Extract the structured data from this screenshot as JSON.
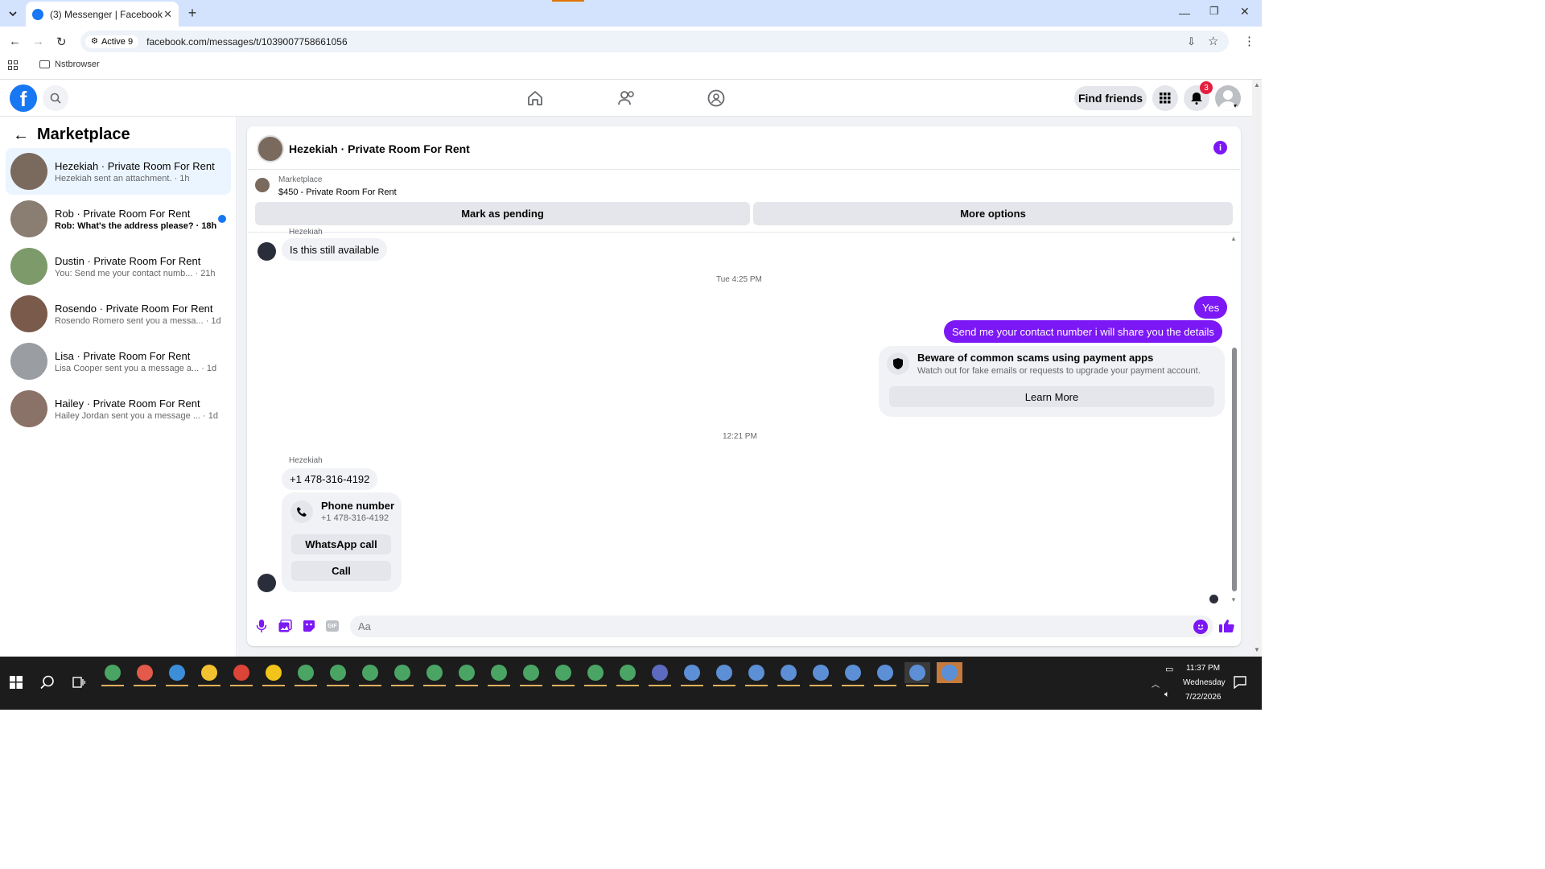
{
  "browser": {
    "tab_title": "(3) Messenger | Facebook",
    "new_tab": "+",
    "site_info": "Active 9",
    "url": "facebook.com/messages/t/1039007758661056",
    "bookmark": "Nstbrowser"
  },
  "fb_header": {
    "find_friends": "Find friends",
    "notif_count": "3"
  },
  "left": {
    "title": "Marketplace",
    "conversations": [
      {
        "name": "Hezekiah · Private Room For Rent",
        "sub": "Hezekiah sent an attachment. · 1h",
        "selected": true,
        "unread": false,
        "color": "#7a6a5e"
      },
      {
        "name": "Rob · Private Room For Rent",
        "sub": "Rob: What's the address please? · 18h",
        "selected": false,
        "unread": true,
        "color": "#8a7d72"
      },
      {
        "name": "Dustin · Private Room For Rent",
        "sub": "You: Send me your contact numb... · 21h",
        "selected": false,
        "unread": false,
        "color": "#7d9a6a"
      },
      {
        "name": "Rosendo · Private Room For Rent",
        "sub": "Rosendo Romero sent you a messa... · 1d",
        "selected": false,
        "unread": false,
        "color": "#7a5a4a"
      },
      {
        "name": "Lisa · Private Room For Rent",
        "sub": "Lisa Cooper sent you a message a... · 1d",
        "selected": false,
        "unread": false,
        "color": "#9a9da2"
      },
      {
        "name": "Hailey · Private Room For Rent",
        "sub": "Hailey Jordan sent you a message ... · 1d",
        "selected": false,
        "unread": false,
        "color": "#8a7268"
      }
    ]
  },
  "chat": {
    "title": "Hezekiah · Private Room For Rent",
    "listing_source": "Marketplace",
    "listing": "$450 - Private Room For Rent",
    "mark_pending": "Mark as pending",
    "more_options": "More options",
    "cut_sender": "Hezekiah",
    "msg1": "Is this still available",
    "time1": "Tue 4:25 PM",
    "out1": "Yes",
    "out2": "Send me your contact number i will share you the details",
    "scam_title": "Beware of common scams using payment apps",
    "scam_body": "Watch out for fake emails or requests to upgrade your payment account.",
    "learn_more": "Learn More",
    "time2": "12:21 PM",
    "sender": "Hezekiah",
    "msg2": "+1 478-316-4192",
    "phone_label": "Phone number",
    "phone_value": "+1 478-316-4192",
    "whatsapp": "WhatsApp call",
    "call": "Call",
    "composer_placeholder": "Aa"
  },
  "colors": {
    "accent": "#7b18f5",
    "fb_blue": "#1877f2",
    "badge": "#e41e3f"
  },
  "taskbar": {
    "time": "11:37 PM",
    "day": "Wednesday",
    "date": "7/22/2026"
  }
}
